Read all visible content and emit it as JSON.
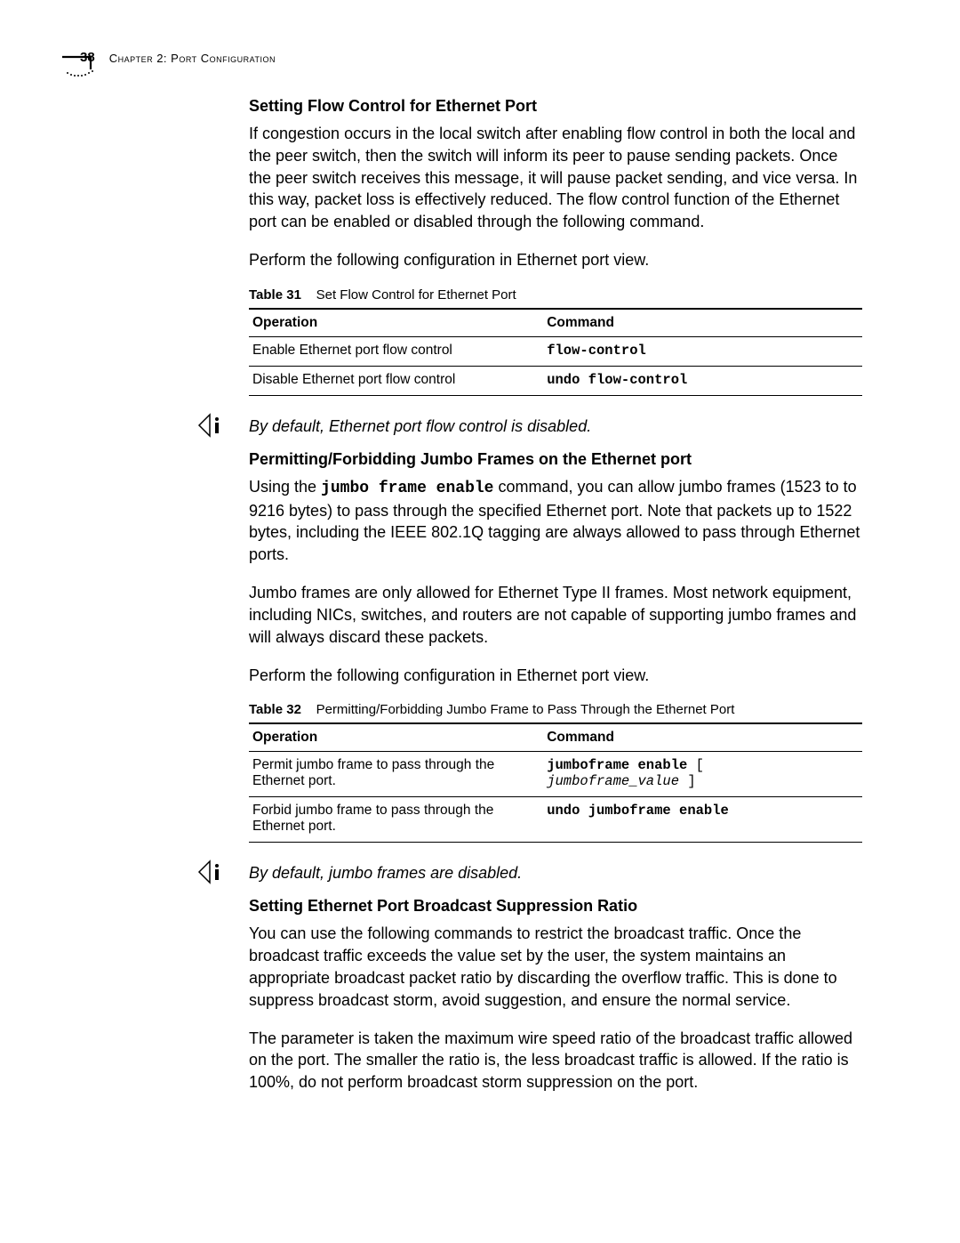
{
  "header": {
    "page_number": "38",
    "chapter_label": "Chapter 2: Port Configuration"
  },
  "sections": {
    "flow_control": {
      "heading": "Setting Flow Control for Ethernet Port",
      "para1": "If congestion occurs in the local switch after enabling flow control in both the local and the peer switch, then the switch will inform its peer to pause sending packets. Once the peer switch receives this message, it will pause packet sending, and vice versa. In this way, packet loss is effectively reduced. The flow control function of the Ethernet port can be enabled or disabled through the following command.",
      "para2": "Perform the following configuration in Ethernet port view.",
      "table_caption_label": "Table 31",
      "table_caption_text": "Set Flow Control for Ethernet Port",
      "col_operation": "Operation",
      "col_command": "Command",
      "rows": {
        "r1_op": "Enable Ethernet port flow control",
        "r1_cmd": "flow-control",
        "r2_op": "Disable Ethernet port flow control",
        "r2_cmd": "undo flow-control"
      },
      "note": "By default, Ethernet port flow control is disabled."
    },
    "jumbo": {
      "heading": "Permitting/Forbidding Jumbo Frames on the Ethernet port",
      "para1_a": "Using the ",
      "para1_cmd": "jumbo frame enable",
      "para1_b": " command, you can allow jumbo frames (1523 to to 9216 bytes) to pass through the specified Ethernet port. Note that packets up to 1522 bytes, including the IEEE 802.1Q tagging are always allowed to pass through Ethernet ports.",
      "para2": "Jumbo frames are only allowed for Ethernet Type II frames. Most network equipment, including NICs, switches, and routers are not capable of supporting jumbo frames and will always discard these packets.",
      "para3": "Perform the following configuration in Ethernet port view.",
      "table_caption_label": "Table 32",
      "table_caption_text": "Permitting/Forbidding Jumbo Frame to Pass Through the Ethernet Port",
      "col_operation": "Operation",
      "col_command": "Command",
      "rows": {
        "r1_op": "Permit jumbo frame to pass through the Ethernet port.",
        "r1_cmd_bold": "jumboframe enable",
        "r1_cmd_open": " [ ",
        "r1_cmd_italic": "jumboframe_value",
        "r1_cmd_close": " ]",
        "r2_op": "Forbid jumbo frame to pass through the Ethernet port.",
        "r2_cmd": "undo jumboframe enable"
      },
      "note": "By default, jumbo frames are disabled."
    },
    "broadcast": {
      "heading": "Setting Ethernet Port Broadcast Suppression Ratio",
      "para1": "You can use the following commands to restrict the broadcast traffic. Once the broadcast traffic exceeds the value set by the user, the system maintains an appropriate broadcast packet ratio by discarding the overflow traffic. This is done to suppress broadcast storm, avoid suggestion, and ensure the normal service.",
      "para2": "The parameter is taken the maximum wire speed ratio of the broadcast traffic allowed on the port. The smaller the ratio is, the less broadcast traffic is allowed. If the ratio is 100%, do not perform broadcast storm suppression on the port."
    }
  }
}
